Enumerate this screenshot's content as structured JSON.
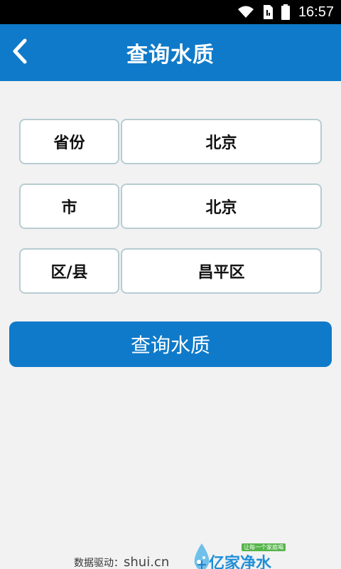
{
  "status_bar": {
    "time": "16:57",
    "icons": [
      "wifi-icon",
      "sim-icon",
      "battery-icon"
    ]
  },
  "header": {
    "title": "查询水质",
    "back_icon": "chevron-left-icon"
  },
  "form": {
    "rows": [
      {
        "label": "省份",
        "value": "北京"
      },
      {
        "label": "市",
        "value": "北京"
      },
      {
        "label": "区/县",
        "value": "昌平区"
      }
    ]
  },
  "query_button": {
    "label": "查询水质"
  },
  "footer": {
    "source_prefix": "数据驱动：",
    "source_domain": "shui.cn",
    "brand_name": "亿家净水",
    "brand_badge": "让每一个家庭喝"
  },
  "colors": {
    "primary": "#0f7ac9",
    "background": "#f2f2f2",
    "field_border": "#b7ccd2",
    "brand_green": "#56b54a"
  }
}
